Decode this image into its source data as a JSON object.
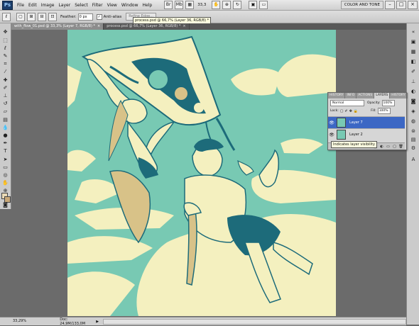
{
  "app": {
    "logo": "Ps",
    "workspace_label": "COLOR AND TONE"
  },
  "menu": [
    "File",
    "Edit",
    "Image",
    "Layer",
    "Select",
    "Filter",
    "View",
    "Window",
    "Help"
  ],
  "menubar_icons": [
    "bridge-icon",
    "mini-bridge-icon",
    "zoom-level",
    "arrangement-icon",
    "screen-mode-icon"
  ],
  "zoom_menubar": "33,3",
  "window_controls": [
    "minimize",
    "maximize",
    "close"
  ],
  "options": {
    "feather_label": "Feather:",
    "feather_value": "0 px",
    "antialias_label": "Anti-alias",
    "refine_label": "Refine Edge..."
  },
  "tooltip_top": "process.psd @ 66,7% (Layer 36, RGB/8) *",
  "tabs": [
    {
      "label": "with_flow_01.psd @ 33,3% (Layer 7, RGB/8) *",
      "active": false
    },
    {
      "label": "process.psd @ 66,7% (Layer 36, RGB/8) *",
      "active": true
    }
  ],
  "layers_panel": {
    "tabs": [
      "HISTORY",
      "INFO",
      "ACTIONS",
      "LAYERS",
      "HISTORY"
    ],
    "active_tab": "LAYERS",
    "blend_mode": "Normal",
    "opacity_label": "Opacity:",
    "opacity_value": "100%",
    "lock_label": "Lock:",
    "fill_label": "Fill:",
    "fill_value": "100%",
    "layers": [
      {
        "name": "Layer 7",
        "selected": true
      },
      {
        "name": "Layer 2",
        "selected": false
      }
    ]
  },
  "tooltip_layer": "Indicates layer visibility",
  "status": {
    "zoom": "33,29%",
    "doc_info": "Doc: 24,9M/133,0M"
  },
  "colors": {
    "canvas_bg": "#78c9b3",
    "cream": "#f4f0bf",
    "dark_teal": "#1d6b7a",
    "tan": "#d8c288",
    "selection": "#3c67c4"
  }
}
